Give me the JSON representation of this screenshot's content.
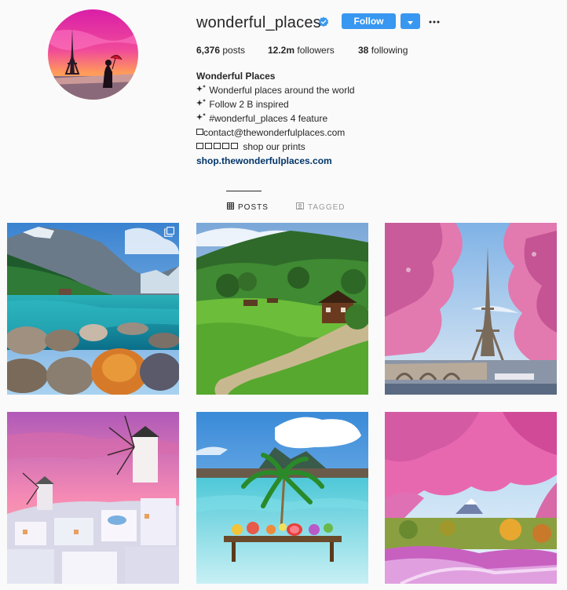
{
  "profile": {
    "username": "wonderful_places",
    "follow_label": "Follow",
    "stats": {
      "posts_count": "6,376",
      "posts_label": "posts",
      "followers_count": "12.2m",
      "followers_label": "followers",
      "following_count": "38",
      "following_label": "following"
    },
    "bio": {
      "name": "Wonderful Places",
      "lines": [
        "Wonderful places around the world",
        "Follow 2 B inspired",
        "#wonderful_places 4 feature",
        "contact@thewonderfulplaces.com",
        "shop our prints"
      ],
      "link": "shop.thewonderfulplaces.com"
    }
  },
  "tabs": {
    "posts": "POSTS",
    "tagged": "TAGGED"
  },
  "icons": {
    "verified": "verified-badge-icon",
    "dropdown": "caret-down-icon",
    "more": "more-horizontal-icon",
    "sparkle": "sparkles-icon",
    "mail": "envelope-icon",
    "grid": "grid-icon",
    "tag": "tag-icon",
    "multi": "multiple-photos-icon"
  },
  "colors": {
    "accent": "#3897f0",
    "link": "#003569",
    "muted": "#999999",
    "text": "#262626",
    "background": "#fafafa"
  },
  "posts": [
    {
      "subject": "mountain lake"
    },
    {
      "subject": "green valley"
    },
    {
      "subject": "eiffel tower with pink blossoms"
    },
    {
      "subject": "windmill on white village"
    },
    {
      "subject": "fruit table in turquoise water"
    },
    {
      "subject": "pink cherry blossoms with mount fuji"
    }
  ]
}
